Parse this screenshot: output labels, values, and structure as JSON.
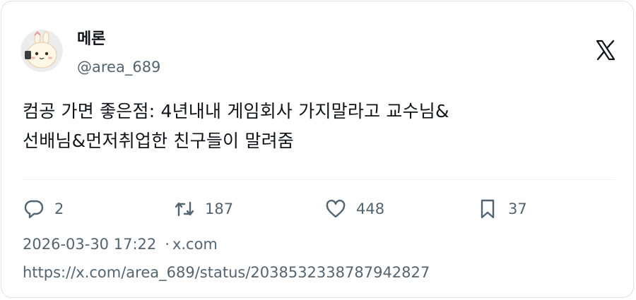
{
  "author": {
    "display_name": "메론",
    "handle": "@area_689",
    "avatar_icon": "bunny-avatar-icon"
  },
  "logo_icon": "x-logo-icon",
  "tweet": {
    "text_line1": "컴공 가면 좋은점: 4년내내 게임회사 가지말라고 교수님&",
    "text_line2": "선배님&먼저취업한 친구들이 말려줌"
  },
  "actions": {
    "reply": {
      "icon": "reply-icon",
      "count": "2"
    },
    "retweet": {
      "icon": "retweet-icon",
      "count": "187"
    },
    "like": {
      "icon": "heart-icon",
      "count": "448"
    },
    "bookmark": {
      "icon": "bookmark-icon",
      "count": "37"
    }
  },
  "meta": {
    "timestamp": "2026-03-30 17:22",
    "separator": "·",
    "source": "x.com",
    "url": "https://x.com/area_689/status/2038532338787942827"
  },
  "colors": {
    "text_primary": "#0f1419",
    "text_secondary": "#536471",
    "border": "#dfe3e6"
  }
}
